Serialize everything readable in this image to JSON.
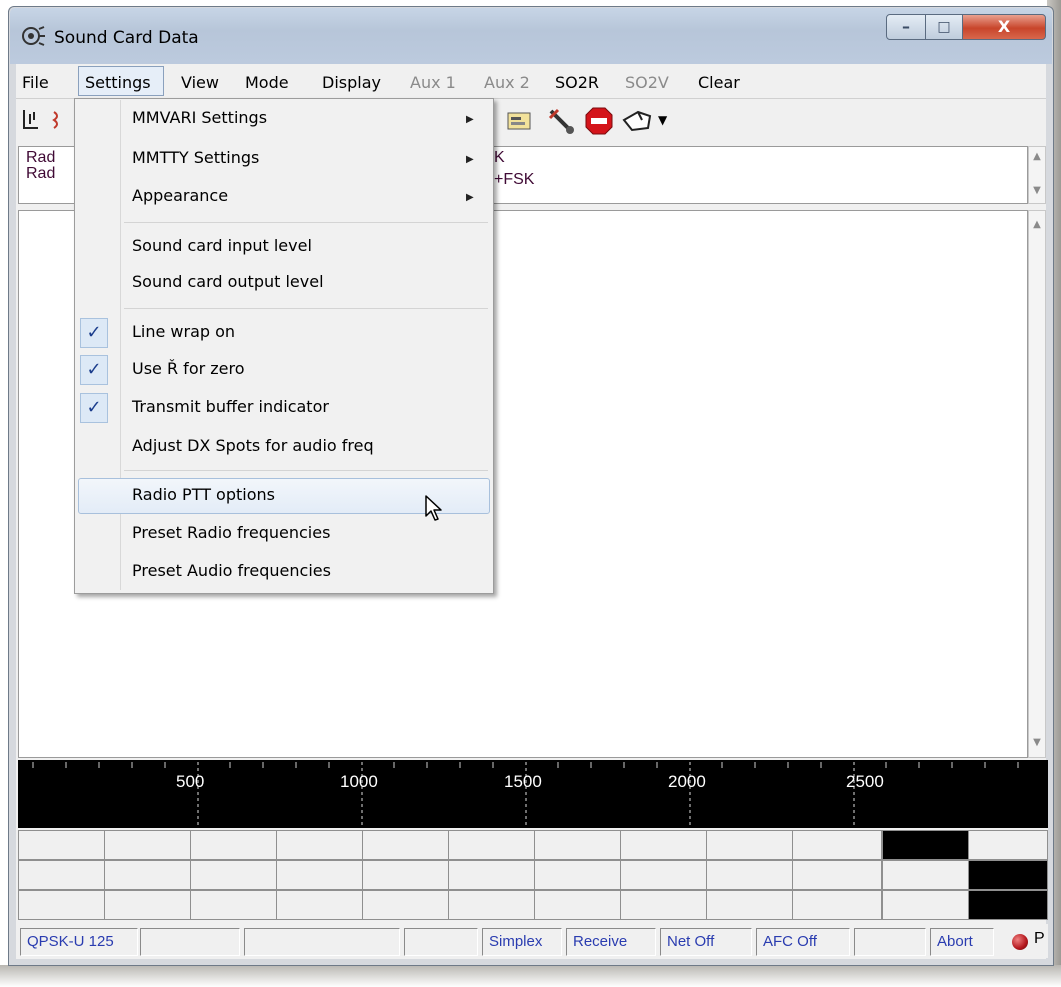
{
  "window": {
    "title": "Sound Card Data",
    "controls": {
      "minimize": "–",
      "maximize": "□",
      "close": "X"
    }
  },
  "menubar": {
    "items": [
      {
        "label": "File",
        "disabled": false
      },
      {
        "label": "Settings",
        "disabled": false
      },
      {
        "label": "View",
        "disabled": false
      },
      {
        "label": "Mode",
        "disabled": false
      },
      {
        "label": "Display",
        "disabled": false
      },
      {
        "label": "Aux 1",
        "disabled": true
      },
      {
        "label": "Aux 2",
        "disabled": true
      },
      {
        "label": "SO2R",
        "disabled": false
      },
      {
        "label": "SO2V",
        "disabled": true
      },
      {
        "label": "Clear",
        "disabled": false
      }
    ]
  },
  "toolbar": {
    "icons": [
      "rx-antenna-icon",
      "tx-icon",
      "card-icon",
      "tools-icon",
      "stop-icon",
      "hand-pointer-icon",
      "dropdown-arrow-icon"
    ]
  },
  "top_panel": {
    "lines": [
      {
        "left": "Rad",
        "right": "K"
      },
      {
        "left": "Rad",
        "right": "+FSK"
      }
    ]
  },
  "settings_menu": {
    "items": [
      {
        "label": "MMVARI Settings",
        "submenu": true
      },
      {
        "label": "MMTTY Settings",
        "submenu": true
      },
      {
        "label": "Appearance",
        "submenu": true
      },
      {
        "label": "Sound card input level"
      },
      {
        "label": "Sound card output level"
      },
      {
        "label": "Line wrap on",
        "checked": true
      },
      {
        "label": "Use Ř for zero",
        "checked": true
      },
      {
        "label": "Transmit buffer indicator",
        "checked": true
      },
      {
        "label": "Adjust DX Spots for audio freq"
      },
      {
        "label": "Radio PTT options",
        "highlighted": true
      },
      {
        "label": "Preset Radio frequencies"
      },
      {
        "label": "Preset Audio frequencies"
      }
    ],
    "check_glyph": "✓"
  },
  "waterfall": {
    "ticks": [
      "500",
      "1000",
      "1500",
      "2000",
      "2500"
    ]
  },
  "statusbar": {
    "mode": "QPSK-U 125",
    "duplex": "Simplex",
    "rx_tx": "Receive",
    "net": "Net Off",
    "afc": "AFC Off",
    "abort": "Abort",
    "ptt_indicator": "P"
  },
  "colors": {
    "status_text": "#2a3cb0",
    "panel_text": "#400a35",
    "check": "#1b3d8c",
    "waterfall_bg": "#000000"
  }
}
